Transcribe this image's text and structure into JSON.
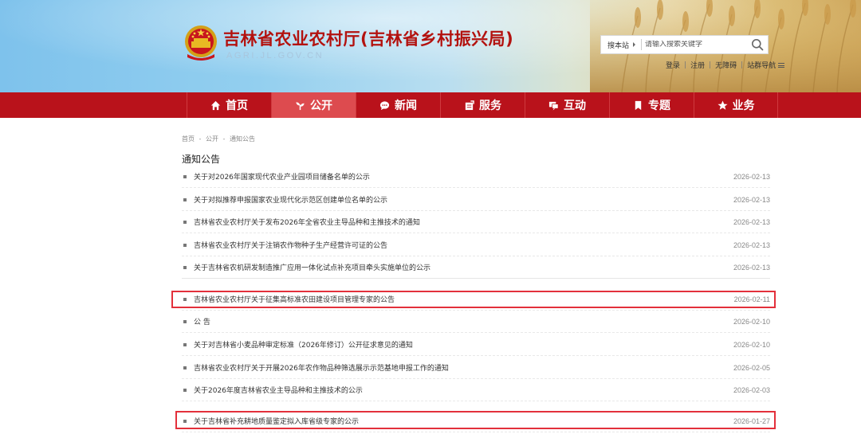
{
  "header": {
    "site_title": "吉林省农业农村厅(吉林省乡村振兴局)",
    "site_domain": "AGRI.JL.GOV.CN",
    "search": {
      "scope_label": "搜本站",
      "placeholder": "请输入搜索关键字"
    },
    "top_links": [
      "登录",
      "注册",
      "无障碍",
      "站群导航"
    ]
  },
  "nav": {
    "items": [
      {
        "label": "首页",
        "icon": "home-icon"
      },
      {
        "label": "公开",
        "icon": "sprout-icon",
        "active": true
      },
      {
        "label": "新闻",
        "icon": "chat-icon"
      },
      {
        "label": "服务",
        "icon": "document-icon"
      },
      {
        "label": "互动",
        "icon": "dialog-icon"
      },
      {
        "label": "专题",
        "icon": "bookmark-icon"
      },
      {
        "label": "业务",
        "icon": "star-icon"
      }
    ]
  },
  "breadcrumb": {
    "items": [
      "首页",
      "公开",
      "通知公告"
    ],
    "separator": "-"
  },
  "section_title": "通知公告",
  "notices": [
    {
      "title": "关于对2026年国家现代农业产业园项目储备名单的公示",
      "date": "2026-02-13"
    },
    {
      "title": "关于对拟推荐申报国家农业现代化示范区创建单位名单的公示",
      "date": "2026-02-13"
    },
    {
      "title": "吉林省农业农村厅关于发布2026年全省农业主导品种和主推技术的通知",
      "date": "2026-02-13"
    },
    {
      "title": "吉林省农业农村厅关于注销农作物种子生产经营许可证的公告",
      "date": "2026-02-13"
    },
    {
      "title": "关于吉林省农机研发制造推广应用一体化试点补充项目牵头实施单位的公示",
      "date": "2026-02-13"
    },
    {
      "title": "吉林省农业农村厅关于征集高标准农田建设项目管理专家的公告",
      "date": "2026-02-11",
      "highlighted": true
    },
    {
      "title": "公 告",
      "date": "2026-02-10"
    },
    {
      "title": "关于对吉林省小麦品种审定标准（2026年修订）公开征求意见的通知",
      "date": "2026-02-10"
    },
    {
      "title": "吉林省农业农村厅关于开展2026年农作物品种筛选展示示范基地申报工作的通知",
      "date": "2026-02-05"
    },
    {
      "title": "关于2026年度吉林省农业主导品种和主推技术的公示",
      "date": "2026-02-03"
    },
    {
      "title": "关于吉林省补充耕地质量鉴定拟入库省级专家的公示",
      "date": "2026-01-27",
      "highlighted": true
    }
  ],
  "colors": {
    "nav_bg": "#b9121b",
    "nav_active": "#dd4b4f",
    "title_red": "#b3120f",
    "highlight_border": "#e3303b"
  }
}
